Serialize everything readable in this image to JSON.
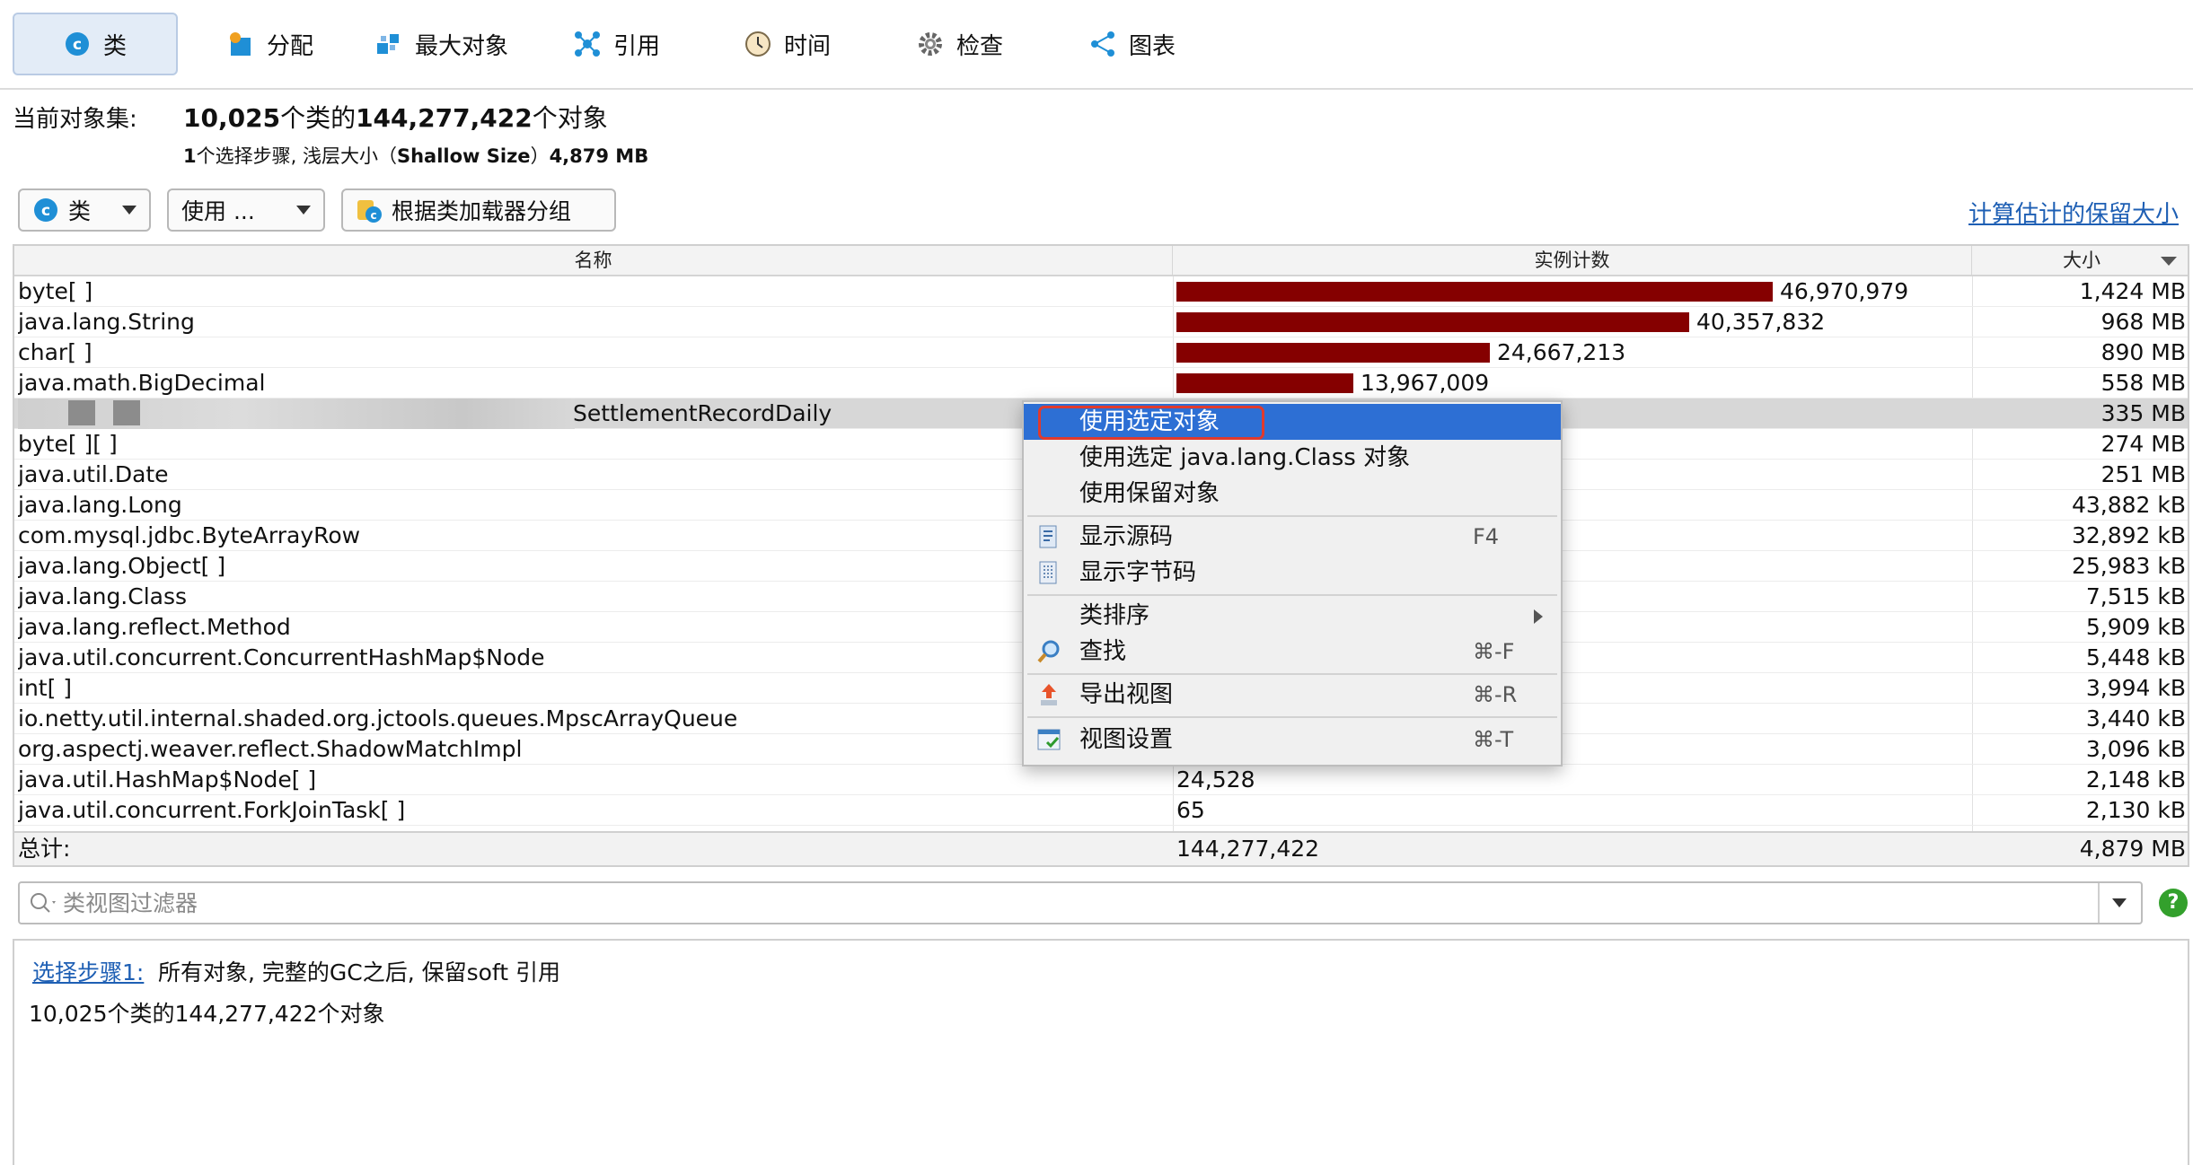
{
  "tabs": [
    {
      "label": "类",
      "icon": "class-icon"
    },
    {
      "label": "分配",
      "icon": "allocation-icon"
    },
    {
      "label": "最大对象",
      "icon": "biggest-objects-icon"
    },
    {
      "label": "引用",
      "icon": "references-icon"
    },
    {
      "label": "时间",
      "icon": "clock-icon"
    },
    {
      "label": "检查",
      "icon": "gear-icon"
    },
    {
      "label": "图表",
      "icon": "graph-icon"
    }
  ],
  "summary": {
    "label": "当前对象集:",
    "main_count_classes": "10,025",
    "main_mid": "个类的",
    "main_count_objects": "144,277,422",
    "main_tail": "个对象",
    "sub_steps": "1",
    "sub_text": "个选择步骤, 浅层大小（",
    "sub_shallow": "Shallow Size",
    "sub_close": "）",
    "sub_size": "4,879 MB"
  },
  "toolbar": {
    "class_dropdown": "类",
    "use_dropdown": "使用 ...",
    "group_button": "根据类加载器分组",
    "calc_link": "计算估计的保留大小"
  },
  "table": {
    "columns": [
      "名称",
      "实例计数",
      "大小"
    ],
    "bar_max": 46970979,
    "rows": [
      {
        "name": "byte[ ]",
        "count": "46,970,979",
        "count_value": 46970979,
        "size": "1,424 MB",
        "bar": true
      },
      {
        "name": "java.lang.String",
        "count": "40,357,832",
        "count_value": 40357832,
        "size": "968 MB",
        "bar": true
      },
      {
        "name": "char[ ]",
        "count": "24,667,213",
        "count_value": 24667213,
        "size": "890 MB",
        "bar": true
      },
      {
        "name": "java.math.BigDecimal",
        "count": "13,967,009",
        "count_value": 13967009,
        "size": "558 MB",
        "bar": true
      },
      {
        "name": "SettlementRecordDaily",
        "count": "",
        "size": "335 MB",
        "bar": false,
        "selected": true,
        "obscured_prefix": true
      },
      {
        "name": "byte[ ][ ]",
        "count": "",
        "size": "274 MB",
        "bar": false
      },
      {
        "name": "java.util.Date",
        "count": "",
        "size": "251 MB",
        "bar": false
      },
      {
        "name": "java.lang.Long",
        "count": "",
        "size": "43,882 kB",
        "bar": false
      },
      {
        "name": "com.mysql.jdbc.ByteArrayRow",
        "count": "",
        "size": "32,892 kB",
        "bar": false
      },
      {
        "name": "java.lang.Object[ ]",
        "count": "",
        "size": "25,983 kB",
        "bar": false
      },
      {
        "name": "java.lang.Class",
        "count": "",
        "size": "7,515 kB",
        "bar": false
      },
      {
        "name": "java.lang.reflect.Method",
        "count": "",
        "size": "5,909 kB",
        "bar": false
      },
      {
        "name": "java.util.concurrent.ConcurrentHashMap$Node",
        "count": "",
        "size": "5,448 kB",
        "bar": false
      },
      {
        "name": "int[ ]",
        "count": "",
        "size": "3,994 kB",
        "bar": false
      },
      {
        "name": "io.netty.util.internal.shaded.org.jctools.queues.MpscArrayQueue",
        "count": "",
        "size": "3,440 kB",
        "bar": false
      },
      {
        "name": "org.aspectj.weaver.reflect.ShadowMatchImpl",
        "count": "",
        "size": "3,096 kB",
        "bar": false
      },
      {
        "name": "java.util.HashMap$Node[ ]",
        "count": "24,528",
        "size": "2,148 kB",
        "bar": false
      },
      {
        "name": "java.util.concurrent.ForkJoinTask[ ]",
        "count": "65",
        "size": "2,130 kB",
        "bar": false
      }
    ],
    "total": {
      "label": "总计:",
      "count": "144,277,422",
      "size": "4,879 MB"
    }
  },
  "filter": {
    "placeholder": "类视图过滤器",
    "help": "?"
  },
  "bottom": {
    "step_link": "选择步骤1:",
    "step_text": "所有对象, 完整的GC之后, 保留soft 引用",
    "result": "10,025个类的144,277,422个对象"
  },
  "context_menu": {
    "items": [
      {
        "label": "使用选定对象",
        "highlighted": true
      },
      {
        "label": "使用选定 java.lang.Class 对象"
      },
      {
        "label": "使用保留对象"
      },
      {
        "label": "显示源码",
        "shortcut": "F4",
        "icon": "source-code-icon"
      },
      {
        "label": "显示字节码",
        "icon": "bytecode-icon"
      },
      {
        "label": "类排序",
        "submenu": true
      },
      {
        "label": "查找",
        "shortcut": "⌘-F",
        "icon": "find-icon"
      },
      {
        "label": "导出视图",
        "shortcut": "⌘-R",
        "icon": "export-icon"
      },
      {
        "label": "视图设置",
        "shortcut": "⌘-T",
        "icon": "view-settings-icon"
      }
    ]
  },
  "colors": {
    "bar": "#850000",
    "accent": "#2d6fd4",
    "link": "#1e5fb4",
    "highlight_ring": "#e03a2d"
  }
}
